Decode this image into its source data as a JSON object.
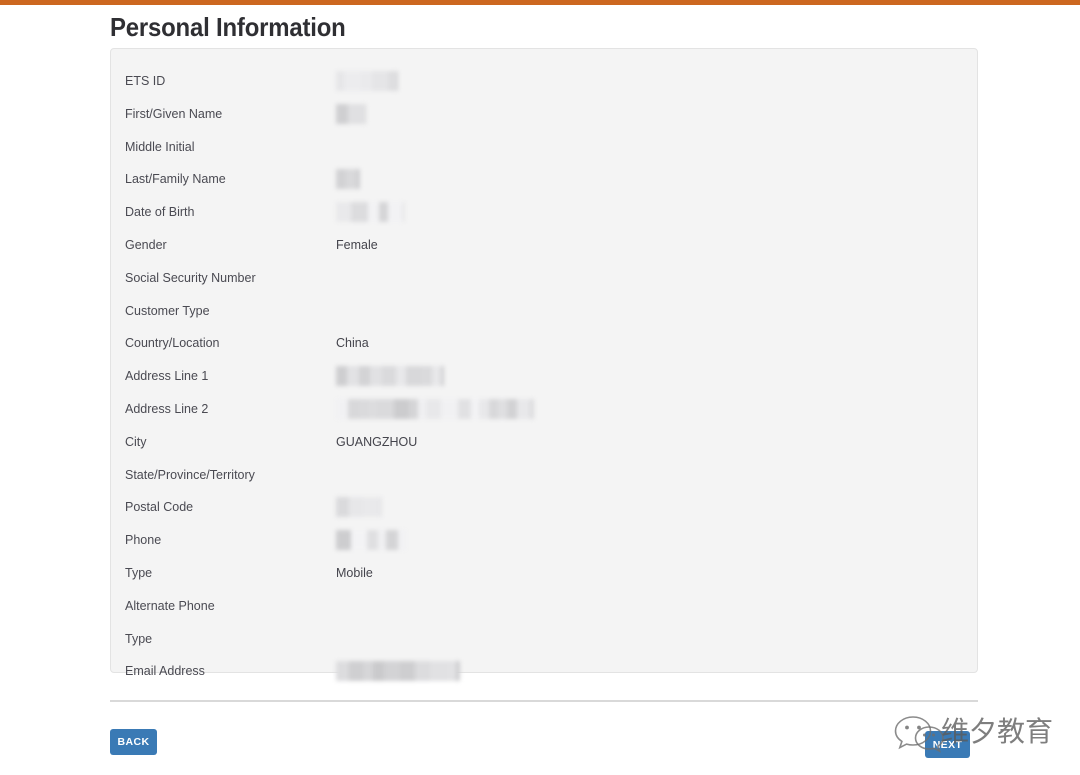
{
  "theme": {
    "accent_bar_color": "#cc6720",
    "button_color": "#3a7ab5",
    "card_background": "#f4f4f4",
    "page_background": "#ffffff"
  },
  "header": {
    "title": "Personal Information"
  },
  "form": {
    "fields": [
      {
        "label": "ETS ID",
        "value": "",
        "redacted": true,
        "redaction_width": 62
      },
      {
        "label": "First/Given Name",
        "value": "",
        "redacted": true,
        "redaction_width": 30
      },
      {
        "label": "Middle Initial",
        "value": "",
        "redacted": false,
        "redaction_width": 0
      },
      {
        "label": "Last/Family Name",
        "value": "",
        "redacted": true,
        "redaction_width": 24
      },
      {
        "label": "Date of Birth",
        "value": "",
        "redacted": true,
        "redaction_width": 68
      },
      {
        "label": "Gender",
        "value": "Female",
        "redacted": false,
        "redaction_width": 0
      },
      {
        "label": "Social Security Number",
        "value": "",
        "redacted": false,
        "redaction_width": 0
      },
      {
        "label": "Customer Type",
        "value": "",
        "redacted": false,
        "redaction_width": 0
      },
      {
        "label": "Country/Location",
        "value": "China",
        "redacted": false,
        "redaction_width": 0
      },
      {
        "label": "Address Line 1",
        "value": "",
        "redacted": true,
        "redaction_width": 108
      },
      {
        "label": "Address Line 2",
        "value": "",
        "redacted": true,
        "redaction_width": 198
      },
      {
        "label": "City",
        "value": "GUANGZHOU",
        "redacted": false,
        "redaction_width": 0
      },
      {
        "label": "State/Province/Territory",
        "value": "",
        "redacted": false,
        "redaction_width": 0
      },
      {
        "label": "Postal Code",
        "value": "",
        "redacted": true,
        "redaction_width": 46
      },
      {
        "label": "Phone",
        "value": "",
        "redacted": true,
        "redaction_width": 70
      },
      {
        "label": "Type",
        "value": "Mobile",
        "redacted": false,
        "redaction_width": 0
      },
      {
        "label": "Alternate Phone",
        "value": "",
        "redacted": false,
        "redaction_width": 0
      },
      {
        "label": "Type",
        "value": "",
        "redacted": false,
        "redaction_width": 0
      },
      {
        "label": "Email Address",
        "value": "",
        "redacted": true,
        "redaction_width": 124
      }
    ]
  },
  "footer": {
    "back_label": "BACK",
    "next_label": "NEXT"
  },
  "watermark": {
    "text": "维夕教育",
    "icon": "wechat-icon"
  }
}
